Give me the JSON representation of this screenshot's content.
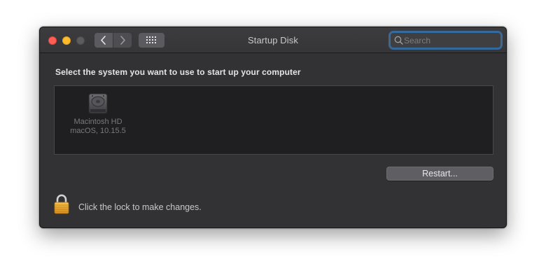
{
  "window": {
    "title": "Startup Disk",
    "traffic_lights": {
      "close": "#fe5f57",
      "minimize": "#febc2e",
      "zoom": "#5c5c5f"
    }
  },
  "toolbar": {
    "back_icon": "chevron-left-icon",
    "forward_icon": "chevron-right-icon",
    "show_all_icon": "grid-icon",
    "search": {
      "placeholder": "Search",
      "value": ""
    }
  },
  "main": {
    "heading": "Select the system you want to use to start up your computer",
    "disks": [
      {
        "name": "Macintosh HD",
        "os": "macOS, 10.15.5",
        "icon": "hard-drive-icon"
      }
    ],
    "restart_label": "Restart..."
  },
  "footer": {
    "lock_icon": "padlock-icon",
    "lock_text": "Click the lock to make changes."
  },
  "colors": {
    "window_bg": "#323235",
    "focus_ring": "#408cdc",
    "lock_gold": "#e8a530"
  }
}
